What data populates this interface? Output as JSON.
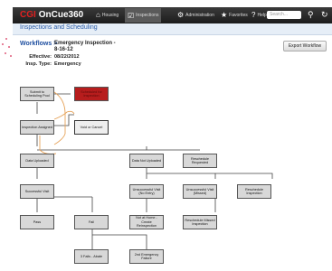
{
  "app": {
    "logo_prefix": "CGI",
    "logo_name": "OnCue360"
  },
  "nav": [
    {
      "label": "Housing",
      "icon": "home-icon",
      "glyph": "⌂"
    },
    {
      "label": "Inspections",
      "icon": "checklist-icon",
      "glyph": "☑"
    },
    {
      "label": "Administration",
      "icon": "gear-icon",
      "glyph": "⚙"
    },
    {
      "label": "Favorites",
      "icon": "star-icon",
      "glyph": "★"
    },
    {
      "label": "Help",
      "icon": "help-icon",
      "glyph": "?"
    }
  ],
  "search": {
    "placeholder": "Search..."
  },
  "page": {
    "title": "Inspections and Scheduling"
  },
  "workflow": {
    "link": "Workflows >",
    "name_line1": "Emergency Inspection -",
    "name_line2": "8-16-12",
    "effective_label": "Effective:",
    "effective_value": "08/22/2012",
    "type_label": "Insp. Type:",
    "type_value": "Emergency",
    "export_label": "Export Workflow"
  },
  "nodes": [
    {
      "id": "submit",
      "label": "Submit to Scheduling Pool",
      "style": "normal"
    },
    {
      "id": "red",
      "label": "Scheduled for Inspection",
      "style": "red"
    },
    {
      "id": "assigned",
      "label": "Inspection Assigned",
      "style": "normal"
    },
    {
      "id": "void",
      "label": "Void or Cancel",
      "style": "light"
    },
    {
      "id": "uploaded",
      "label": "Data Uploaded",
      "style": "normal"
    },
    {
      "id": "notuploaded",
      "label": "Data Not Uploaded",
      "style": "normal"
    },
    {
      "id": "resched",
      "label": "Reschedule Requested",
      "style": "normal"
    },
    {
      "id": "success",
      "label": "Successful Visit",
      "style": "normal"
    },
    {
      "id": "unsucc_noentry",
      "label": "Unsuccessful Visit (No Entry)",
      "style": "normal"
    },
    {
      "id": "unsucc_missed",
      "label": "Unsuccessful Visit (Missed)",
      "style": "normal"
    },
    {
      "id": "resched_insp",
      "label": "Reschedule Inspection",
      "style": "normal"
    },
    {
      "id": "pass",
      "label": "Pass",
      "style": "normal"
    },
    {
      "id": "fail",
      "label": "Fail",
      "style": "normal"
    },
    {
      "id": "nothome",
      "label": "Not at Home - Create Reinspection",
      "style": "normal"
    },
    {
      "id": "resched_missed",
      "label": "Reschedule Missed Inspection",
      "style": "normal"
    },
    {
      "id": "fail3",
      "label": "3 Fails - Abate",
      "style": "normal"
    },
    {
      "id": "emerg2",
      "label": "2nd Emergency Failure",
      "style": "normal"
    }
  ]
}
